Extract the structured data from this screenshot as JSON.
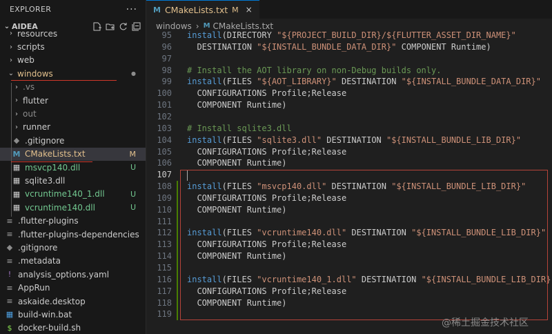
{
  "sidebar": {
    "title": "EXPLORER",
    "more_label": "···",
    "project": "AIDEA",
    "items": [
      {
        "label": "resources",
        "chev": "›",
        "color": "#cccccc"
      },
      {
        "label": "scripts",
        "chev": "›",
        "color": "#cccccc"
      },
      {
        "label": "web",
        "chev": "›",
        "color": "#cccccc"
      },
      {
        "label": "windows",
        "chev": "⌄",
        "color": "#e2c08d",
        "badge": "●"
      },
      {
        "label": ".vs",
        "chev": "›",
        "color": "#8c8c8c"
      },
      {
        "label": "flutter",
        "chev": "›",
        "color": "#cccccc"
      },
      {
        "label": "out",
        "chev": "›",
        "color": "#8c8c8c"
      },
      {
        "label": "runner",
        "chev": "›",
        "color": "#cccccc"
      },
      {
        "label": ".gitignore",
        "icon": "git-icon",
        "color": "#cccccc"
      },
      {
        "label": "CMakeLists.txt",
        "icon": "cmake-icon",
        "color": "#e2c08d",
        "badge": "M"
      },
      {
        "label": "msvcp140.dll",
        "icon": "dll-icon",
        "color": "#73c991",
        "badge": "U"
      },
      {
        "label": "sqlite3.dll",
        "icon": "dll-icon",
        "color": "#cccccc"
      },
      {
        "label": "vcruntime140_1.dll",
        "icon": "dll-icon",
        "color": "#73c991",
        "badge": "U"
      },
      {
        "label": "vcruntime140.dll",
        "icon": "dll-icon",
        "color": "#73c991",
        "badge": "U"
      },
      {
        "label": ".flutter-plugins",
        "icon": "file-icon",
        "color": "#cccccc"
      },
      {
        "label": ".flutter-plugins-dependencies",
        "icon": "file-icon",
        "color": "#cccccc"
      },
      {
        "label": ".gitignore",
        "icon": "git-icon",
        "color": "#cccccc"
      },
      {
        "label": ".metadata",
        "icon": "file-icon",
        "color": "#cccccc"
      },
      {
        "label": "analysis_options.yaml",
        "icon": "yaml-icon",
        "color": "#cccccc"
      },
      {
        "label": "AppRun",
        "icon": "file-icon",
        "color": "#cccccc"
      },
      {
        "label": "askaide.desktop",
        "icon": "file-icon",
        "color": "#cccccc"
      },
      {
        "label": "build-win.bat",
        "icon": "windows-icon",
        "color": "#cccccc"
      },
      {
        "label": "docker-build.sh",
        "icon": "shell-icon",
        "color": "#cccccc"
      }
    ]
  },
  "tab": {
    "label": "CMakeLists.txt",
    "badge": "M",
    "close": "×",
    "icon": "M"
  },
  "breadcrumbs": {
    "folder": "windows",
    "sep": "›",
    "file": "CMakeLists.txt",
    "icon": "M"
  },
  "code": [
    {
      "n": "95",
      "parts": [
        [
          "kw",
          "install"
        ],
        [
          "p",
          "(DIRECTORY "
        ],
        [
          "str",
          "\"${PROJECT_BUILD_DIR}/${FLUTTER_ASSET_DIR_NAME}\""
        ]
      ]
    },
    {
      "n": "96",
      "parts": [
        [
          "p",
          "  DESTINATION "
        ],
        [
          "str",
          "\"${INSTALL_BUNDLE_DATA_DIR}\""
        ],
        [
          "p",
          " COMPONENT Runtime)"
        ]
      ]
    },
    {
      "n": "97",
      "parts": []
    },
    {
      "n": "98",
      "parts": [
        [
          "cmt",
          "# Install the AOT library on non-Debug builds only."
        ]
      ]
    },
    {
      "n": "99",
      "parts": [
        [
          "kw",
          "install"
        ],
        [
          "p",
          "(FILES "
        ],
        [
          "str",
          "\"${AOT_LIBRARY}\""
        ],
        [
          "p",
          " DESTINATION "
        ],
        [
          "str",
          "\"${INSTALL_BUNDLE_DATA_DIR}\""
        ]
      ]
    },
    {
      "n": "100",
      "parts": [
        [
          "p",
          "  CONFIGURATIONS Profile;Release"
        ]
      ]
    },
    {
      "n": "101",
      "parts": [
        [
          "p",
          "  COMPONENT Runtime)"
        ]
      ]
    },
    {
      "n": "102",
      "parts": []
    },
    {
      "n": "103",
      "parts": [
        [
          "cmt",
          "# Install sqlite3.dll"
        ]
      ]
    },
    {
      "n": "104",
      "parts": [
        [
          "kw",
          "install"
        ],
        [
          "p",
          "(FILES "
        ],
        [
          "str",
          "\"sqlite3.dll\""
        ],
        [
          "p",
          " DESTINATION "
        ],
        [
          "str",
          "\"${INSTALL_BUNDLE_LIB_DIR}\""
        ]
      ]
    },
    {
      "n": "105",
      "parts": [
        [
          "p",
          "  CONFIGURATIONS Profile;Release"
        ]
      ]
    },
    {
      "n": "106",
      "parts": [
        [
          "p",
          "  COMPONENT Runtime)"
        ]
      ]
    },
    {
      "n": "107",
      "parts": [],
      "active": true
    },
    {
      "n": "108",
      "parts": [
        [
          "kw",
          "install"
        ],
        [
          "p",
          "(FILES "
        ],
        [
          "str",
          "\"msvcp140.dll\""
        ],
        [
          "p",
          " DESTINATION "
        ],
        [
          "str",
          "\"${INSTALL_BUNDLE_LIB_DIR}\""
        ]
      ]
    },
    {
      "n": "109",
      "parts": [
        [
          "p",
          "  CONFIGURATIONS Profile;Release"
        ]
      ]
    },
    {
      "n": "110",
      "parts": [
        [
          "p",
          "  COMPONENT Runtime)"
        ]
      ]
    },
    {
      "n": "111",
      "parts": []
    },
    {
      "n": "112",
      "parts": [
        [
          "kw",
          "install"
        ],
        [
          "p",
          "(FILES "
        ],
        [
          "str",
          "\"vcruntime140.dll\""
        ],
        [
          "p",
          " DESTINATION "
        ],
        [
          "str",
          "\"${INSTALL_BUNDLE_LIB_DIR}\""
        ]
      ]
    },
    {
      "n": "113",
      "parts": [
        [
          "p",
          "  CONFIGURATIONS Profile;Release"
        ]
      ]
    },
    {
      "n": "114",
      "parts": [
        [
          "p",
          "  COMPONENT Runtime)"
        ]
      ]
    },
    {
      "n": "115",
      "parts": []
    },
    {
      "n": "116",
      "parts": [
        [
          "kw",
          "install"
        ],
        [
          "p",
          "(FILES "
        ],
        [
          "str",
          "\"vcruntime140_1.dll\""
        ],
        [
          "p",
          " DESTINATION "
        ],
        [
          "str",
          "\"${INSTALL_BUNDLE_LIB_DIR}\""
        ]
      ]
    },
    {
      "n": "117",
      "parts": [
        [
          "p",
          "  CONFIGURATIONS Profile;Release"
        ]
      ]
    },
    {
      "n": "118",
      "parts": [
        [
          "p",
          "  COMPONENT Runtime)"
        ]
      ]
    },
    {
      "n": "119",
      "parts": []
    }
  ],
  "watermark": "@稀土掘金技术社区",
  "colors": {
    "accent": "#0078d4",
    "modified": "#e2c08d",
    "untracked": "#73c991",
    "highlight": "#d0382a"
  }
}
